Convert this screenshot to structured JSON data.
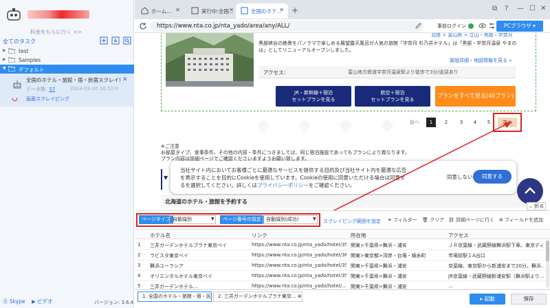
{
  "left": {
    "subtitle": "料金をもらに行く >>",
    "tasks_title": "全てのタスク",
    "tree": [
      {
        "label": "test",
        "selected": false
      },
      {
        "label": "Samples",
        "selected": false
      },
      {
        "label": "デフォルト",
        "selected": true
      }
    ],
    "task": {
      "name": "全国のホテル・旅館・宿・民宿スクレイピング",
      "data_label": "データ数:",
      "data_count": "57",
      "date": "2024-03-20 16:52:0",
      "status": "画面スクレイピング"
    },
    "footer": {
      "skype": "Skype",
      "video": "ビデオ",
      "version": "バージョン: 3.6.4"
    }
  },
  "browser": {
    "tabs": [
      "ホーム...",
      "実行中:全国...",
      "全国のホテ..."
    ],
    "url": "https://www.nta.co.jp/nta_yado/area/any/ALL/",
    "prelogin": "事前ログイン",
    "pc_browser": "PCブラウザ"
  },
  "web": {
    "breadcrumb": "北陸 > 富山県 > 立山・黒部・宇奈月",
    "description": "黒部峡谷の絶景をパノラマで楽しめる展望露天風呂が人気の旅館「宇奈月 杉乃井ホテル」は「黒部・宇奈月温泉 やまのは」としてリニューアルオープンしました。",
    "detail_link": "施設詳細・地図情報を見る",
    "access_label": "アクセス：",
    "access_value": "富山地方鉄道宇奈月温泉駅より徒歩で3分/送迎あり",
    "btn_jr": "JR・新幹線＋宿泊\nセットプランを見る",
    "btn_air": "航空＋宿泊\nセットプランを見る",
    "btn_all": "プランをすべて見る(46プラン)",
    "pager": {
      "prev": "前へ",
      "pages": [
        "1",
        "2",
        "3",
        "4",
        "5"
      ],
      "next": "次へ"
    },
    "note": "※ご注意\nお部屋タイプ、食事条件、その他の内容・条件につきましては、同じ宿泊施設であってもプランにより異なります。\nプラン内容は詳細ページでご確認くださいますようお願い致します。",
    "cookie_text_a": "当社サイト内においてお客様ごとに最適なサービスを提供する目的及び当社サイト内を最適な広告を表示することを目的にCookieを使用しています。Cookieの使用に同意いただける場合は同意するを選択してください。詳しくは",
    "cookie_link": "プライバシーポリシー",
    "cookie_text_b": "をご確認ください。",
    "deny": "同意しない",
    "agree": "同意する",
    "hokkaido": "北海道のホテル・旅館を予約する",
    "fold": "折る"
  },
  "panel": {
    "page_type_label": "ページタイプ",
    "page_type_value": "自動識別",
    "page_num_label": "ページ番号の設定",
    "page_num_value": "自動識別(成功)",
    "scrape_range": "スクレイピング範囲を設定",
    "filter": "フィルター",
    "clear": "クリア",
    "detail_page": "詳細ページに行く",
    "add_field": "フィールドを追加",
    "columns": [
      "ホテル名",
      "リンク",
      "所在地",
      "アクセス"
    ],
    "rows": [
      [
        "1",
        "三井ガーデンホテルプラナ東京ベイ",
        "https://www.nta.co.jp/nta_yado/hotel/3559-3...",
        "関東>千葉県>舞浜・浦安",
        "ＪＲ京葉線・武蔵野線舞浜駅下車。東京ディ..."
      ],
      [
        "2",
        "ラビスタ東京ベイ",
        "https://www.nta.co.jp/nta_yado/hotel/3661-3...",
        "関東>東京都>湾岸・台場・錦糸町",
        "市場前駅１A出口"
      ],
      [
        "3",
        "舞浜ユーラシア",
        "https://www.nta.co.jp/nta_yado/hotel/3568-3...",
        "関東>千葉県>舞浜・浦安",
        "京葉線、東京駅から新浦安まで20分。舞浜..."
      ],
      [
        "4",
        "オリエンタルホテル東京ベイ",
        "https://www.nta.co.jp/nta_yado/hotel/3559-3...",
        "関東>千葉県>舞浜・浦安",
        "JR京葉線・武蔵野線新浦安駅（舞浜駅より..."
      ],
      [
        "5",
        "三井ガーデンホテル...",
        "https://www.nta.co.jp/nta_yado/hotel/...",
        "関東>千葉県>舞浜・浦安",
        "..."
      ]
    ],
    "bottom_tabs": [
      "1. 全国のホテル・旅館・宿・民宿",
      "2. 三井ガーデンホテルプラナ東京..."
    ],
    "start": "▸ 起動",
    "save": "保存"
  },
  "colors": {
    "accent": "#2f8cf0",
    "red_highlight": "#e02020",
    "navy": "#1a2a7a",
    "orange": "#ff8c1a"
  }
}
